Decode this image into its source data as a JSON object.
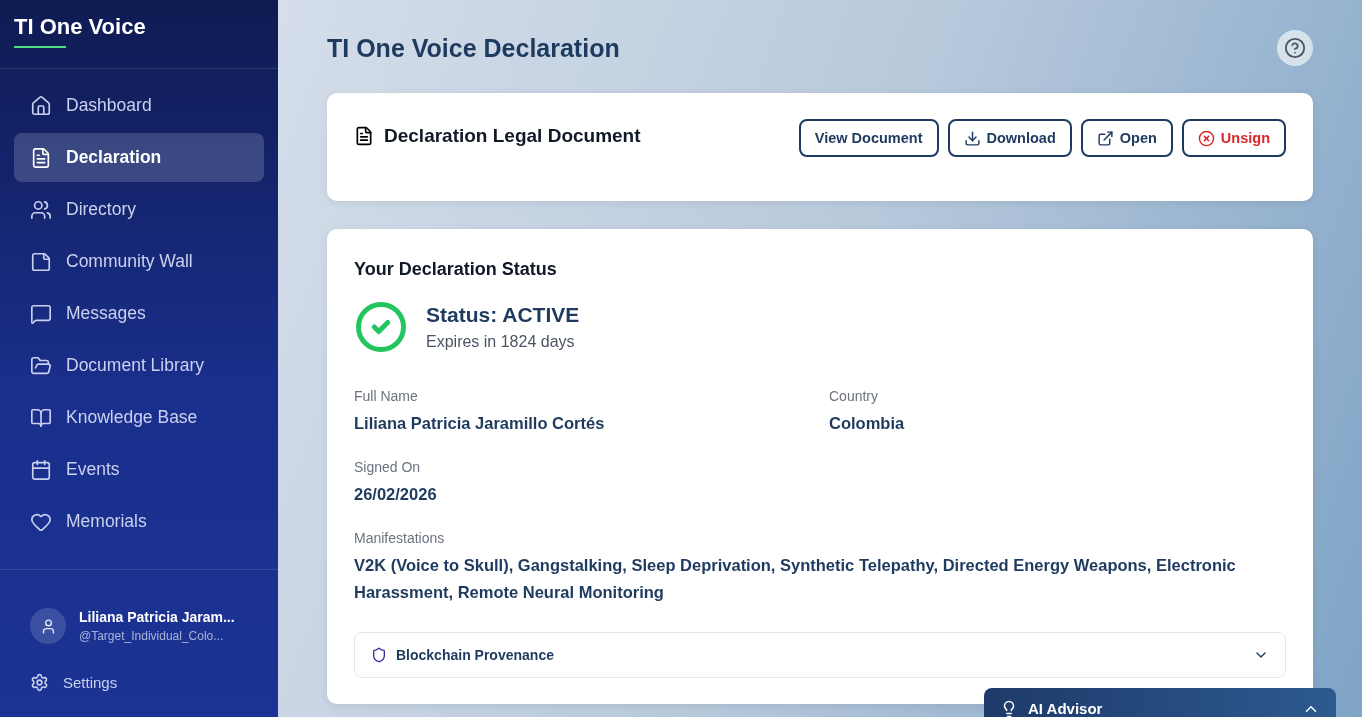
{
  "app": {
    "name": "TI One Voice"
  },
  "nav": [
    {
      "label": "Dashboard",
      "selected": false
    },
    {
      "label": "Declaration",
      "selected": true
    },
    {
      "label": "Directory",
      "selected": false
    },
    {
      "label": "Community Wall",
      "selected": false
    },
    {
      "label": "Messages",
      "selected": false
    },
    {
      "label": "Document Library",
      "selected": false
    },
    {
      "label": "Knowledge Base",
      "selected": false
    },
    {
      "label": "Events",
      "selected": false
    },
    {
      "label": "Memorials",
      "selected": false
    }
  ],
  "user": {
    "name": "Liliana Patricia Jaram...",
    "handle": "@Target_Individual_Colo..."
  },
  "settings": {
    "label": "Settings"
  },
  "page": {
    "title": "TI One Voice Declaration"
  },
  "document_card": {
    "title": "Declaration Legal Document",
    "buttons": [
      {
        "label": "View Document",
        "kind": "plain"
      },
      {
        "label": "Download",
        "kind": "download"
      },
      {
        "label": "Open",
        "kind": "open"
      },
      {
        "label": "Unsign",
        "kind": "danger"
      }
    ]
  },
  "status_card": {
    "title": "Your Declaration Status",
    "status": "Status: ACTIVE",
    "expires": "Expires in 1824 days",
    "fields": [
      {
        "label": "Full Name",
        "value": "Liliana Patricia Jaramillo Cortés"
      },
      {
        "label": "Country",
        "value": "Colombia"
      },
      {
        "label": "Signed On",
        "value": "26/02/2026"
      },
      {
        "label": "Manifestations",
        "value": "V2K (Voice to Skull), Gangstalking, Sleep Deprivation, Synthetic Telepathy, Directed Energy Weapons, Electronic Harassment, Remote Neural Monitoring"
      }
    ],
    "provenance": {
      "label": "Blockchain Provenance",
      "expanded": false
    }
  },
  "advisor": {
    "title": "AI Advisor",
    "expanded": false
  }
}
